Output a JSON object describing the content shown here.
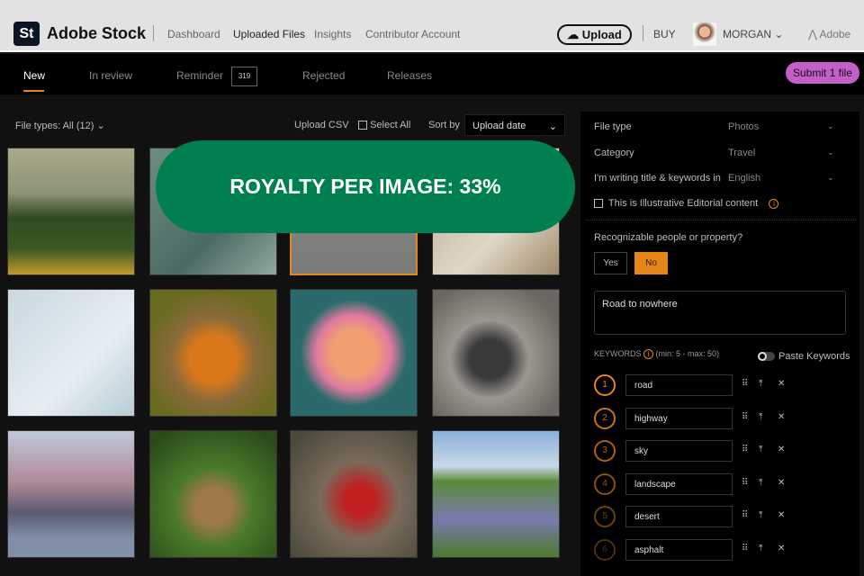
{
  "header": {
    "logo": "St",
    "brand": "Adobe Stock",
    "nav": [
      "Dashboard",
      "Uploaded Files",
      "Insights",
      "Contributor Account"
    ],
    "upload": "Upload",
    "buy": "BUY",
    "user": "MORGAN",
    "adobe": "Adobe"
  },
  "tabs": {
    "items": [
      "New",
      "In review",
      "Reminder",
      "Rejected",
      "Releases"
    ],
    "reminder_count": "319",
    "submit": "Submit 1 file"
  },
  "toolbar": {
    "file_types": "File types: All (12)",
    "upload_csv": "Upload CSV",
    "select_all": "Select All",
    "sort_by": "Sort by",
    "sort_value": "Upload date"
  },
  "banner": "ROYALTY PER IMAGE: 33%",
  "panel": {
    "file_type_label": "File type",
    "file_type": "Photos",
    "category_label": "Category",
    "category": "Travel",
    "language_label": "I'm writing title & keywords in",
    "language": "English",
    "editorial": "This is Illustrative Editorial content",
    "recognizable": "Recognizable people or property?",
    "yes": "Yes",
    "no": "No",
    "title": "Road to nowhere",
    "keywords_label": "KEYWORDS",
    "keywords_range": "(min: 5 - max: 50)",
    "paste": "Paste Keywords",
    "keywords": [
      {
        "n": "1",
        "word": "road"
      },
      {
        "n": "2",
        "word": "highway"
      },
      {
        "n": "3",
        "word": "sky"
      },
      {
        "n": "4",
        "word": "landscape"
      },
      {
        "n": "5",
        "word": "desert"
      },
      {
        "n": "6",
        "word": "asphalt"
      }
    ]
  },
  "colors": {
    "accent": "#e68619",
    "submit": "#c45fc9",
    "banner": "#008050"
  }
}
